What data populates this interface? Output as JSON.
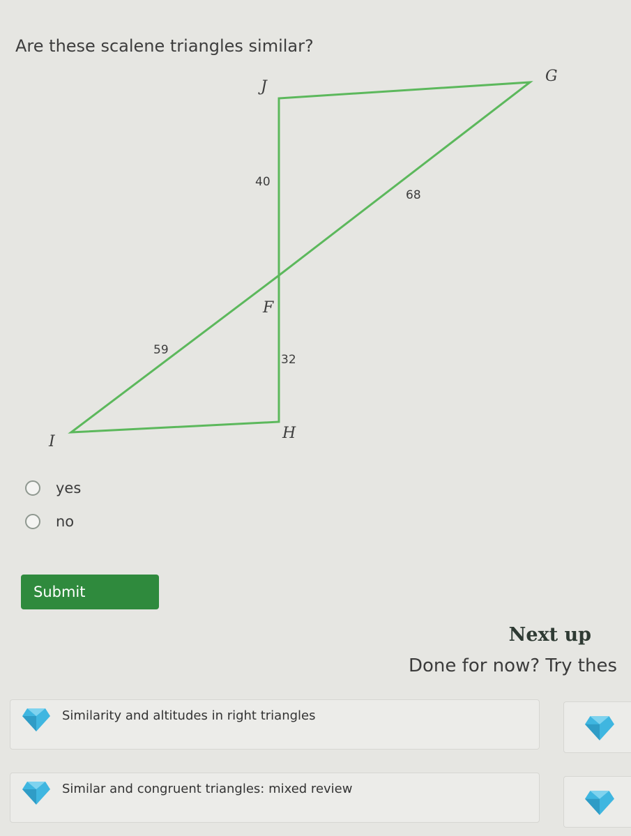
{
  "question": "Are these scalene triangles similar?",
  "figure": {
    "vertices": {
      "J": "J",
      "G": "G",
      "F": "F",
      "I": "I",
      "H": "H"
    },
    "sides": {
      "JF": "40",
      "FG": "68",
      "IF": "59",
      "FH": "32"
    },
    "line_color": "#5cb85c"
  },
  "choices": [
    {
      "label": "yes"
    },
    {
      "label": "no"
    }
  ],
  "submit_label": "Submit",
  "next_up": {
    "heading": "Next up",
    "subtitle": "Done for now? Try thes",
    "cards": [
      {
        "title": "Similarity and altitudes in right triangles",
        "icon": "gem-icon"
      },
      {
        "title": "Similar and congruent triangles: mixed review",
        "icon": "gem-icon"
      }
    ]
  },
  "colors": {
    "accent": "#2f8a3d",
    "gem": "#3fb6e0",
    "background": "#e6e6e2"
  }
}
